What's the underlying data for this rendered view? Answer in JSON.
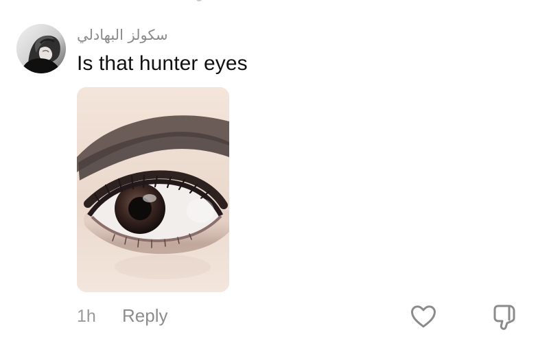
{
  "comment": {
    "author_name": "سكولز البهادلي",
    "text": "Is that hunter eyes",
    "time": "1h"
  },
  "actions": {
    "reply_label": "Reply",
    "like_icon": "heart-icon",
    "dislike_icon": "thumbs-down-icon"
  },
  "colors": {
    "background": "#ffffff",
    "username": "#8a8a8a",
    "comment_text": "#111111",
    "meta_text": "#9a9a9a"
  }
}
